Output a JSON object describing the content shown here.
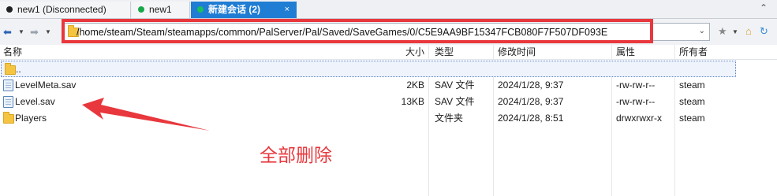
{
  "tabs": [
    {
      "label": "new1 (Disconnected)",
      "dot_color": "#222222"
    },
    {
      "label": "new1",
      "dot_color": "#18a84a"
    },
    {
      "label": "新建会话 (2)",
      "dot_color": "#18c060",
      "close": "×",
      "active": true
    }
  ],
  "toolbar": {
    "path": "/home/steam/Steam/steamapps/common/PalServer/Pal/Saved/SaveGames/0/C5E9AA9BF15347FCB080F7F507DF093E"
  },
  "columns": {
    "name": "名称",
    "size": "大小",
    "type": "类型",
    "modified": "修改时间",
    "attributes": "属性",
    "owner": "所有者"
  },
  "files": [
    {
      "name": "..",
      "size": "",
      "type": "",
      "modified": "",
      "attributes": "",
      "owner": "",
      "kind": "folder"
    },
    {
      "name": "LevelMeta.sav",
      "size": "2KB",
      "type": "SAV 文件",
      "modified": "2024/1/28, 9:37",
      "attributes": "-rw-rw-r--",
      "owner": "steam",
      "kind": "file"
    },
    {
      "name": "Level.sav",
      "size": "13KB",
      "type": "SAV 文件",
      "modified": "2024/1/28, 9:37",
      "attributes": "-rw-rw-r--",
      "owner": "steam",
      "kind": "file"
    },
    {
      "name": "Players",
      "size": "",
      "type": "文件夹",
      "modified": "2024/1/28, 8:51",
      "attributes": "drwxrwxr-x",
      "owner": "steam",
      "kind": "folder"
    }
  ],
  "annotation": {
    "text": "全部删除",
    "color": "#e8383d"
  }
}
